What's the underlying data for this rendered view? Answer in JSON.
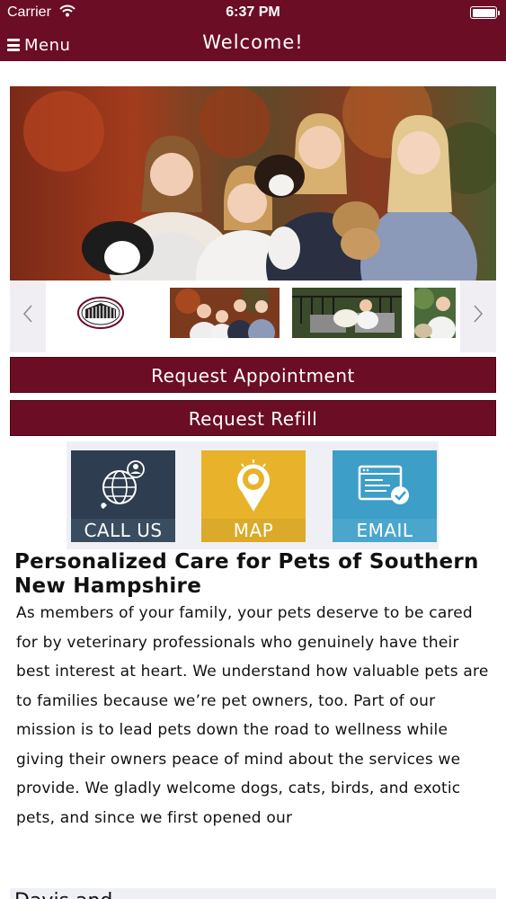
{
  "status_bar": {
    "carrier": "Carrier",
    "time": "6:37 PM"
  },
  "nav": {
    "menu_label": "Menu",
    "title": "Welcome!"
  },
  "buttons": {
    "request_appointment": "Request Appointment",
    "request_refill": "Request Refill"
  },
  "tiles": [
    {
      "label": "CALL US",
      "icon": "globe-phone-icon",
      "color": "#2e3d4f"
    },
    {
      "label": "MAP",
      "icon": "map-pin-icon",
      "color": "#e8b32a"
    },
    {
      "label": "EMAIL",
      "icon": "email-check-icon",
      "color": "#3d9ec8"
    }
  ],
  "content": {
    "title": "Personalized Care for Pets of Southern New Hampshire",
    "body": "As members of your family, your pets deserve to be cared for by veterinary professionals who genuinely have their best interest at heart. We understand how valuable pets are to families because we’re pet owners, too. Part of our mission is to lead pets down the road to wellness while giving their owners peace of mind about the services we provide. We gladly welcome dogs, cats, birds, and exotic pets, and since we first opened our"
  },
  "bottom_peek": "Davis and",
  "colors": {
    "brand": "#6b0d25",
    "tile_call": "#2e3d4f",
    "tile_map": "#e8b32a",
    "tile_email": "#3d9ec8"
  }
}
